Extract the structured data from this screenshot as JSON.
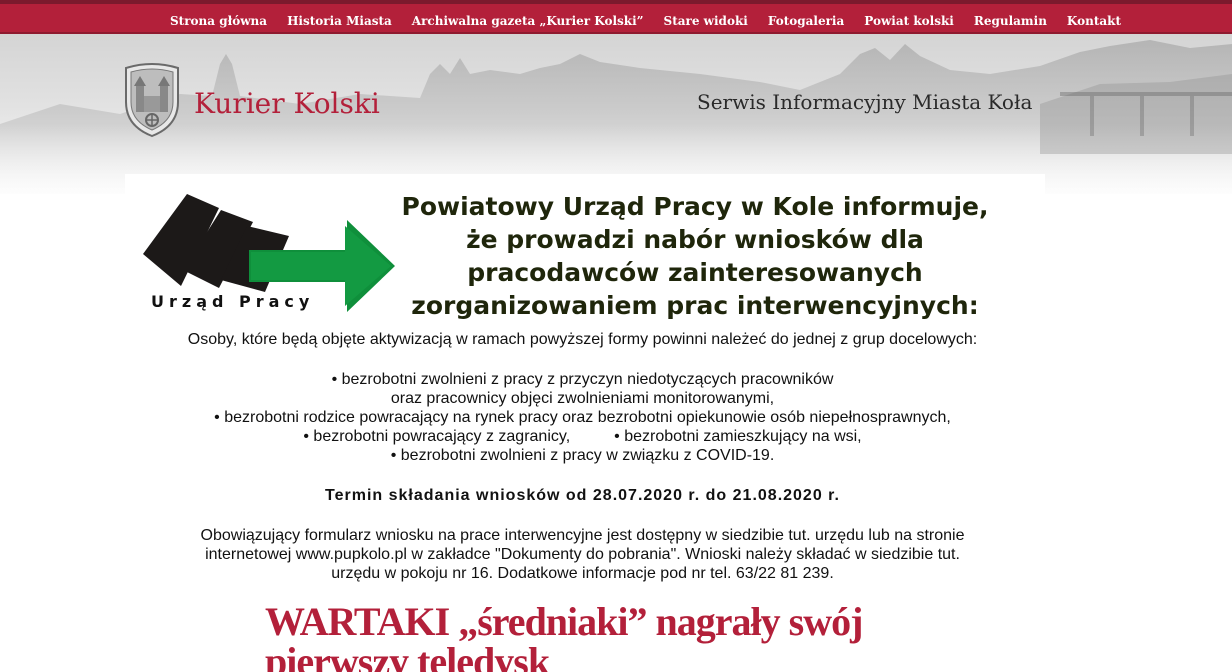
{
  "nav": {
    "items": [
      "Strona główna",
      "Historia Miasta",
      "Archiwalna gazeta „Kurier Kolski”",
      "Stare widoki",
      "Fotogaleria",
      "Powiat kolski",
      "Regulamin",
      "Kontakt"
    ]
  },
  "header": {
    "site_title": "Kurier Kolski",
    "tagline": "Serwis Informacyjny Miasta Koła"
  },
  "ad": {
    "logo_text": "Urząd Pracy",
    "headline_lines": [
      "Powiatowy Urząd Pracy w Kole informuje,",
      "że prowadzi nabór wniosków dla",
      "pracodawców zainteresowanych",
      "zorganizowaniem prac interwencyjnych:"
    ],
    "intro": "Osoby, które będą objęte aktywizacją w ramach powyższej formy powinni należeć do jednej z grup docelowych:",
    "list_lines": [
      "• bezrobotni zwolnieni z pracy z przyczyn niedotyczących pracowników",
      "oraz pracownicy objęci zwolnieniami monitorowanymi,",
      "• bezrobotni rodzice powracający na rynek pracy oraz bezrobotni opiekunowie osób niepełnosprawnych,",
      "• bezrobotni powracający z zagranicy,",
      "• bezrobotni zamieszkujący na wsi,",
      "• bezrobotni zwolnieni z pracy w związku z COVID-19."
    ],
    "deadline": "Termin składania wniosków od 28.07.2020 r. do 21.08.2020 r.",
    "info_lines": [
      "Obowiązujący formularz wniosku na prace interwencyjne jest dostępny w siedzibie tut. urzędu lub na stronie",
      "internetowej www.pupkolo.pl w zakładce \"Dokumenty do pobrania\".  Wnioski należy składać w siedzibie tut.",
      "urzędu w pokoju nr 16. Dodatkowe informacje pod nr tel. 63/22 81 239."
    ]
  },
  "article": {
    "title": "WARTAKI „średniaki” nagrały swój pierwszy teledysk"
  },
  "colors": {
    "brand_red": "#b3203a",
    "arrow_green": "#0f8f3b",
    "headline_dark": "#1f260b"
  },
  "icons": {
    "crest": "city-crest-icon",
    "logo": "urzad-pracy-logo"
  }
}
